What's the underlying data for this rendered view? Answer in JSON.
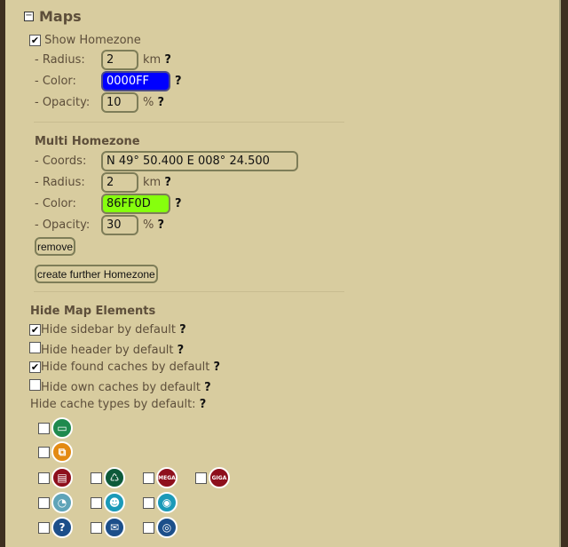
{
  "section": {
    "title": "Maps",
    "toggle": "−"
  },
  "homezone": {
    "show_label": "Show Homezone",
    "show_checked": true,
    "radius_label": "- Radius:",
    "radius": "2",
    "radius_unit": "km",
    "color_label": "- Color:",
    "color": "0000FF",
    "color_hex": "#0000ff",
    "opacity_label": "- Opacity:",
    "opacity": "10",
    "opacity_unit": "%",
    "help": "?"
  },
  "multi": {
    "title": "Multi Homezone",
    "coords_label": "- Coords:",
    "coords": "N 49° 50.400 E 008° 24.500",
    "radius_label": "- Radius:",
    "radius": "2",
    "radius_unit": "km",
    "color_label": "- Color:",
    "color": "86FF0D",
    "color_hex": "#86ff0d",
    "opacity_label": "- Opacity:",
    "opacity": "30",
    "opacity_unit": "%",
    "remove_label": "remove",
    "create_label": "create further Homezone"
  },
  "hide": {
    "title": "Hide Map Elements",
    "items": [
      {
        "label": "Hide sidebar by default",
        "checked": true
      },
      {
        "label": "Hide header by default",
        "checked": false
      },
      {
        "label": "Hide found caches by default",
        "checked": true
      },
      {
        "label": "Hide own caches by default",
        "checked": false
      }
    ],
    "types_label": "Hide cache types by default:",
    "types": [
      {
        "name": "traditional",
        "color": "#1f8a4e",
        "glyph": "▭"
      },
      {
        "name": "multi",
        "color": "#e38a12",
        "glyph": "⧉"
      },
      {
        "name": "event",
        "color": "#8e0f1c",
        "glyph": "▤"
      },
      {
        "name": "cito",
        "color": "#0d5a3a",
        "glyph": "♺"
      },
      {
        "name": "mega",
        "color": "#8e0f1c",
        "glyph": "MEGA"
      },
      {
        "name": "giga",
        "color": "#8e0f1c",
        "glyph": "GIGA"
      },
      {
        "name": "earth",
        "color": "#5fa4b8",
        "glyph": "◔"
      },
      {
        "name": "virtual",
        "color": "#1b9ab8",
        "glyph": "☻"
      },
      {
        "name": "webcam",
        "color": "#1b9ab8",
        "glyph": "◉"
      },
      {
        "name": "mystery",
        "color": "#1c4f8a",
        "glyph": "?"
      },
      {
        "name": "letterbox",
        "color": "#1c4f8a",
        "glyph": "✉"
      },
      {
        "name": "wherigo",
        "color": "#1c4f8a",
        "glyph": "◎"
      }
    ]
  }
}
